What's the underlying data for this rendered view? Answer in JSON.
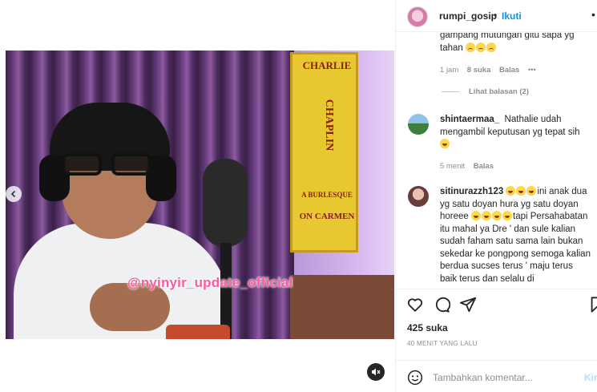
{
  "header": {
    "username": "rumpi_gosip",
    "separator": "•",
    "follow_label": "Ikuti",
    "more_icon": "more-icon"
  },
  "media": {
    "watermark": "@nyinyir_update_official",
    "poster_lines": [
      "CHARLIE",
      "CHAPLIN",
      "A BURLESQUE",
      "ON CARMEN"
    ],
    "prev_icon": "chevron-left-icon",
    "sound_icon": "speaker-muted-icon"
  },
  "comments": {
    "top_fragment": "gampang mutungan gitu sapa yg tahan",
    "top_meta": {
      "time": "1 jam",
      "likes": "8 suka",
      "reply": "Balas"
    },
    "view_replies": "Lihat balasan (2)",
    "items": [
      {
        "user": "shintaermaa_",
        "text": "Nathalie udah mengambil keputusan yg tepat sih",
        "time": "5 menit",
        "reply": "Balas"
      },
      {
        "user": "sitinurazzh123",
        "text_1": "ini anak dua yg satu doyan hura yg satu doyan horeee",
        "text_2": "tapi Persahabatan itu mahal ya Dre ' dan sule kalian sudah faham satu sama lain bukan sekedar ke pongpong semoga kalian berdua sucses terus ' maju terus baik terus dan selalu di"
      }
    ]
  },
  "actions": {
    "likes": "425 suka",
    "time_ago": "40 MENIT YANG LALU",
    "icons": [
      "heart-icon",
      "comment-icon",
      "share-icon",
      "bookmark-icon"
    ]
  },
  "comment_bar": {
    "placeholder": "Tambahkan komentar...",
    "send_label": "Kirim"
  },
  "colors": {
    "accent": "#0095f6",
    "muted": "#8e8e8e",
    "watermark": "#ff5aa0"
  }
}
